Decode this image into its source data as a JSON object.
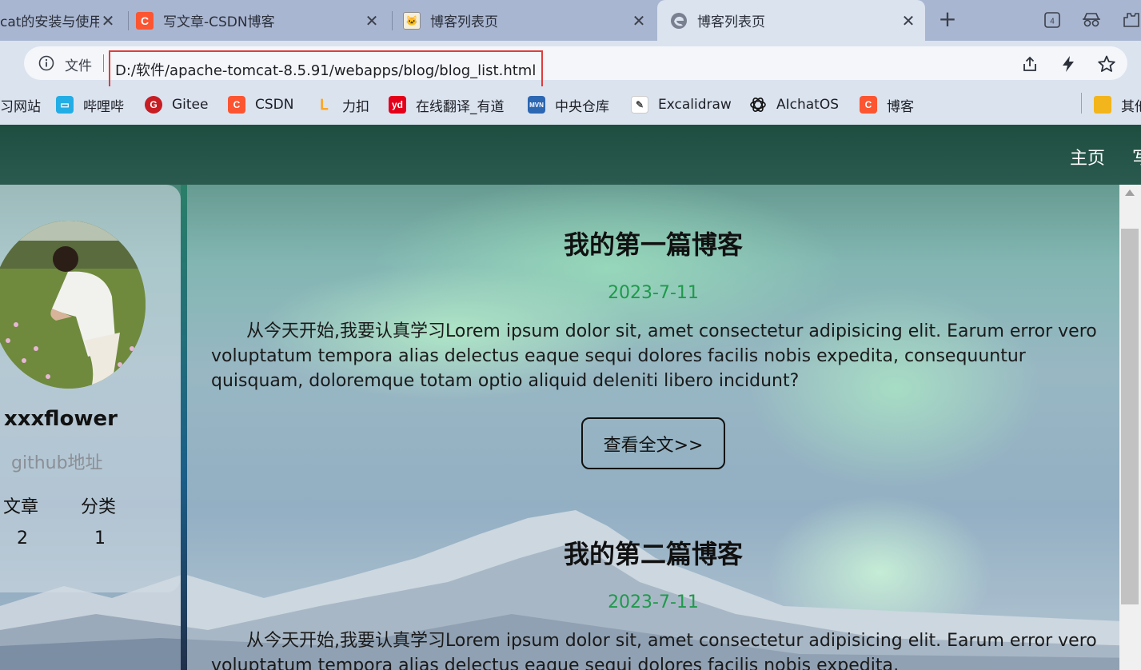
{
  "browser": {
    "tabs": [
      {
        "title": "cat的安装与使用",
        "favicon": "csdn-icon"
      },
      {
        "title": "写文章-CSDN博客",
        "favicon": "csdn-icon"
      },
      {
        "title": "博客列表页",
        "favicon": "tomcat-icon"
      },
      {
        "title": "博客列表页",
        "favicon": "edge-icon",
        "active": true
      }
    ],
    "tab_count": "4",
    "address": {
      "file_label": "文件",
      "url": "D:/软件/apache-tomcat-8.5.91/webapps/blog/blog_list.html",
      "highlight_color": "#e03c3c"
    },
    "bookmarks": [
      {
        "label": "习网站",
        "icon": "none"
      },
      {
        "label": "哔哩哔",
        "icon": "bilibili-icon",
        "color": "#23ade5"
      },
      {
        "label": "Gitee",
        "icon": "gitee-icon",
        "color": "#c71d23"
      },
      {
        "label": "CSDN",
        "icon": "csdn-icon",
        "color": "#fc5531"
      },
      {
        "label": "力扣",
        "icon": "leetcode-icon",
        "color": "#ffa116"
      },
      {
        "label": "在线翻译_有道",
        "icon": "youdao-icon",
        "color": "#e5001a"
      },
      {
        "label": "中央仓库",
        "icon": "maven-icon",
        "color": "#2c67b2"
      },
      {
        "label": "Excalidraw",
        "icon": "excalidraw-icon",
        "color": "#444"
      },
      {
        "label": "AIchatOS",
        "icon": "openai-icon",
        "color": "#111"
      },
      {
        "label": "博客",
        "icon": "csdn-icon",
        "color": "#fc5531"
      },
      {
        "label": "其他",
        "icon": "folder-icon",
        "color": "#f2b51c"
      }
    ]
  },
  "nav": {
    "home": "主页",
    "write": "写"
  },
  "profile": {
    "username": "xxxflower",
    "github": "github地址",
    "articles_label": "文章",
    "categories_label": "分类",
    "articles_count": "2",
    "categories_count": "1"
  },
  "posts": [
    {
      "title": "我的第一篇博客",
      "date": "2023-7-11",
      "body": "从今天开始,我要认真学习Lorem ipsum dolor sit, amet consectetur adipisicing elit. Earum error vero voluptatum tempora alias delectus eaque sequi dolores facilis nobis expedita, consequuntur quisquam, doloremque totam optio aliquid deleniti libero incidunt?",
      "read_more": "查看全文>>"
    },
    {
      "title": "我的第二篇博客",
      "date": "2023-7-11",
      "body": "从今天开始,我要认真学习Lorem ipsum dolor sit, amet consectetur adipisicing elit. Earum error vero voluptatum tempora alias delectus eaque sequi dolores facilis nobis expedita,"
    }
  ],
  "colors": {
    "date_green": "#1e9a4a",
    "divider": "#1b5e88"
  }
}
